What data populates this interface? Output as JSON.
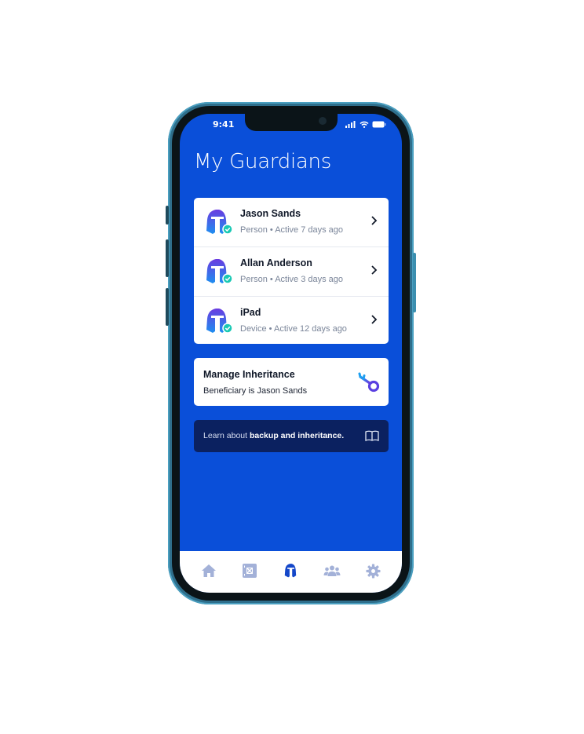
{
  "status_bar": {
    "time": "9:41"
  },
  "page": {
    "title": "My Guardians"
  },
  "guardians": [
    {
      "name": "Jason Sands",
      "subtitle": "Person • Active 7 days ago",
      "icon": "guardian-helmet-icon",
      "verified": true
    },
    {
      "name": "Allan Anderson",
      "subtitle": "Person • Active 3 days ago",
      "icon": "guardian-helmet-icon",
      "verified": true
    },
    {
      "name": "iPad",
      "subtitle": "Device • Active 12 days ago",
      "icon": "guardian-helmet-icon",
      "verified": true
    }
  ],
  "inheritance": {
    "title": "Manage Inheritance",
    "subtitle": "Beneficiary is Jason Sands",
    "icon": "key-icon"
  },
  "learn": {
    "prefix": "Learn about ",
    "bold": "backup and inheritance.",
    "icon": "book-icon"
  },
  "tabbar": {
    "items": [
      {
        "name": "home",
        "icon": "home-icon",
        "active": false
      },
      {
        "name": "vault",
        "icon": "vault-icon",
        "active": false
      },
      {
        "name": "guardians",
        "icon": "helmet-icon",
        "active": true
      },
      {
        "name": "contacts",
        "icon": "people-icon",
        "active": false
      },
      {
        "name": "settings",
        "icon": "gear-icon",
        "active": false
      }
    ]
  },
  "colors": {
    "primary": "#0a4fd9",
    "dark_banner": "#0b2160",
    "tab_inactive": "#a3b1d8",
    "tab_active": "#1447c9",
    "verified": "#19c9b4"
  }
}
